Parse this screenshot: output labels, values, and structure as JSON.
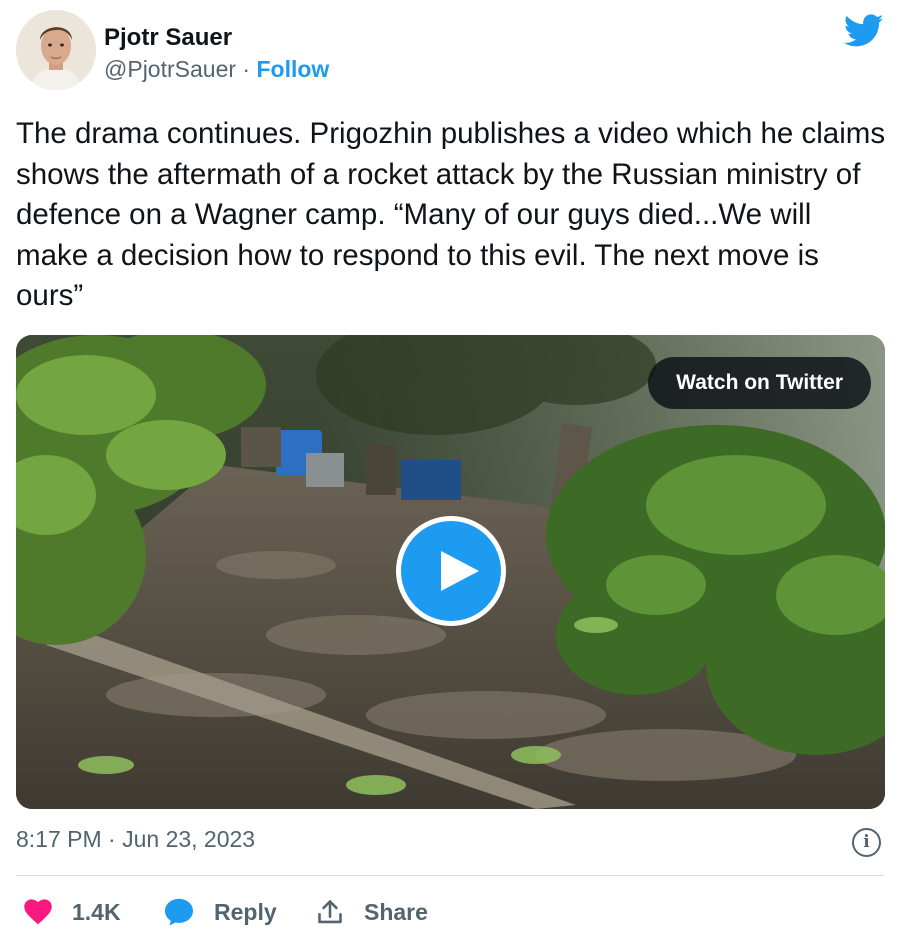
{
  "author": {
    "name": "Pjotr Sauer",
    "handle": "@PjotrSauer",
    "separator": " · ",
    "follow_label": "Follow"
  },
  "tweet": {
    "text": "The drama continues. Prigozhin publishes a video which he claims shows the aftermath of a rocket attack by the Russian ministry of defence on a Wagner camp. “Many of our guys died...We will make a decision how to respond to this evil. The next move is ours”"
  },
  "media": {
    "watch_label": "Watch on Twitter",
    "play_icon": "play-icon"
  },
  "meta": {
    "timestamp": "8:17 PM · Jun 23, 2023",
    "info_glyph": "i"
  },
  "actions": {
    "likes_count": "1.4K",
    "reply_label": "Reply",
    "share_label": "Share"
  },
  "colors": {
    "accent": "#1d9bf0",
    "like": "#f91880",
    "muted": "#536471",
    "text": "#0f1419"
  },
  "icons": {
    "brand": "twitter-bird-icon",
    "like": "heart-icon",
    "reply": "speech-bubble-icon",
    "share": "share-upload-icon",
    "info": "info-icon"
  }
}
